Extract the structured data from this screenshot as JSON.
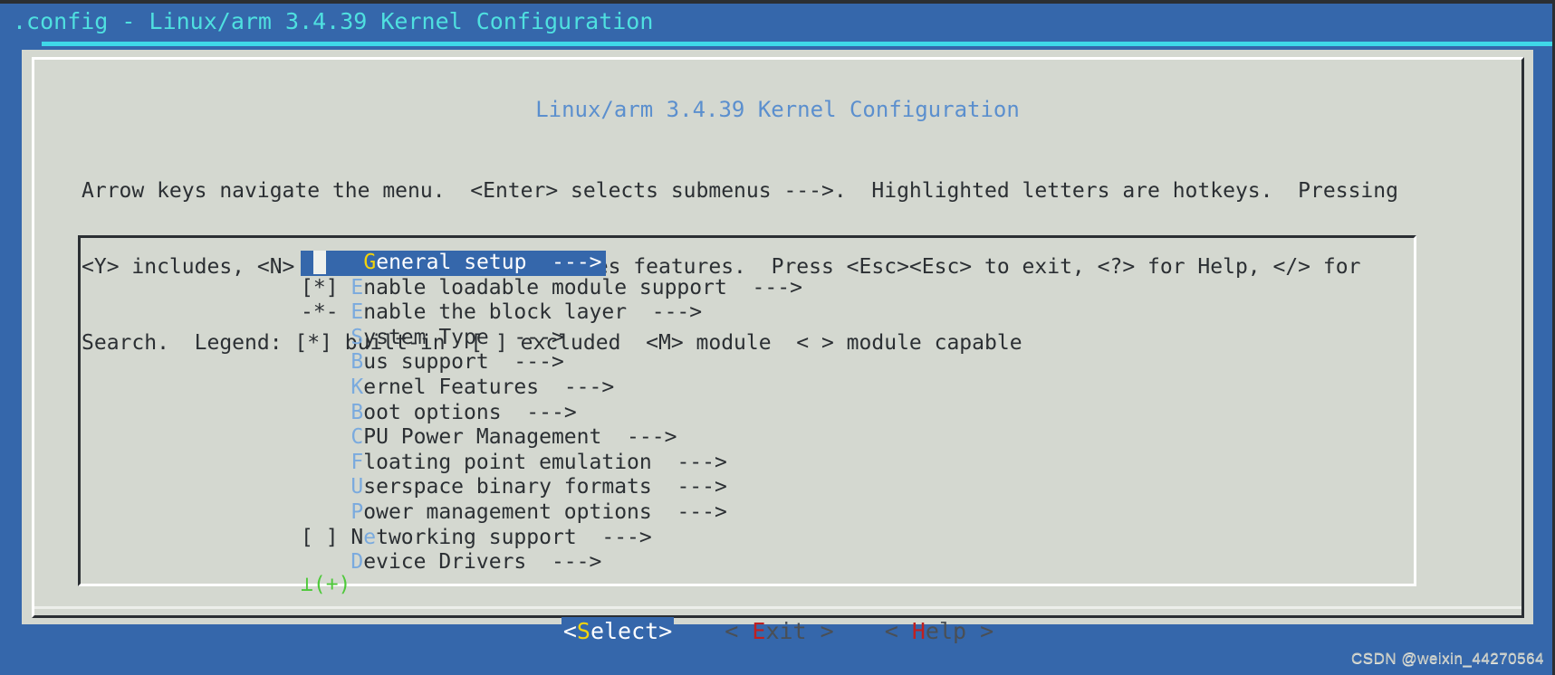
{
  "titlebar": {
    "text": ".config - Linux/arm 3.4.39 Kernel Configuration"
  },
  "dialog": {
    "title": "Linux/arm 3.4.39 Kernel Configuration",
    "help_lines": [
      "Arrow keys navigate the menu.  <Enter> selects submenus --->.  Highlighted letters are hotkeys.  Pressing",
      "<Y> includes, <N> excludes, <M> modularizes features.  Press <Esc><Esc> to exit, <?> for Help, </> for",
      "Search.  Legend: [*] built-in  [ ] excluded  <M> module  < > module capable"
    ],
    "scroll_indicator": "⊥(+)"
  },
  "menu": {
    "items": [
      {
        "prefix": "    ",
        "hot": "G",
        "rest": "eneral setup",
        "arrow": "  --->",
        "selected": true
      },
      {
        "prefix": "[*] ",
        "hot": "E",
        "rest": "nable loadable module support",
        "arrow": "  --->",
        "selected": false
      },
      {
        "prefix": "-*- ",
        "hot": "E",
        "rest": "nable the block layer",
        "arrow": "  --->",
        "selected": false
      },
      {
        "prefix": "    ",
        "hot": "S",
        "rest": "ystem Type",
        "arrow": "  --->",
        "selected": false
      },
      {
        "prefix": "    ",
        "hot": "B",
        "rest": "us support",
        "arrow": "  --->",
        "selected": false
      },
      {
        "prefix": "    ",
        "hot": "K",
        "rest": "ernel Features",
        "arrow": "  --->",
        "selected": false
      },
      {
        "prefix": "    ",
        "hot": "B",
        "rest": "oot options",
        "arrow": "  --->",
        "selected": false
      },
      {
        "prefix": "    ",
        "hot": "C",
        "rest": "PU Power Management",
        "arrow": "  --->",
        "selected": false
      },
      {
        "prefix": "    ",
        "hot": "F",
        "rest": "loating point emulation",
        "arrow": "  --->",
        "selected": false
      },
      {
        "prefix": "    ",
        "hot": "U",
        "rest": "serspace binary formats",
        "arrow": "  --->",
        "selected": false
      },
      {
        "prefix": "    ",
        "hot": "P",
        "rest": "ower management options",
        "arrow": "  --->",
        "selected": false
      },
      {
        "prefix": "[ ] ",
        "pre_hot": "N",
        "hot": "e",
        "rest": "tworking support",
        "arrow": "  --->",
        "selected": false
      },
      {
        "prefix": "    ",
        "hot": "D",
        "rest": "evice Drivers",
        "arrow": "  --->",
        "selected": false
      }
    ]
  },
  "buttons": [
    {
      "left": "<",
      "hot": "S",
      "rest": "elect",
      "right": ">",
      "active": true
    },
    {
      "left": "< ",
      "hot": "E",
      "rest": "xit",
      "right": " >",
      "active": false
    },
    {
      "left": "< ",
      "hot": "H",
      "rest": "elp",
      "right": " >",
      "active": false
    }
  ],
  "watermark": "CSDN @weixin_44270564",
  "colors": {
    "desktop_blue": "#3567ab",
    "title_cyan": "#4fe0e0",
    "rule_cyan": "#3fd8e8",
    "panel_gray": "#d4d8d0",
    "text_dark": "#2b2f33",
    "dialog_title_blue": "#5b8fce",
    "hotkey_blue": "#7aaade",
    "hotkey_yellow": "#f5d40a",
    "hotkey_red": "#c02020",
    "scroll_green": "#4ec93a"
  }
}
